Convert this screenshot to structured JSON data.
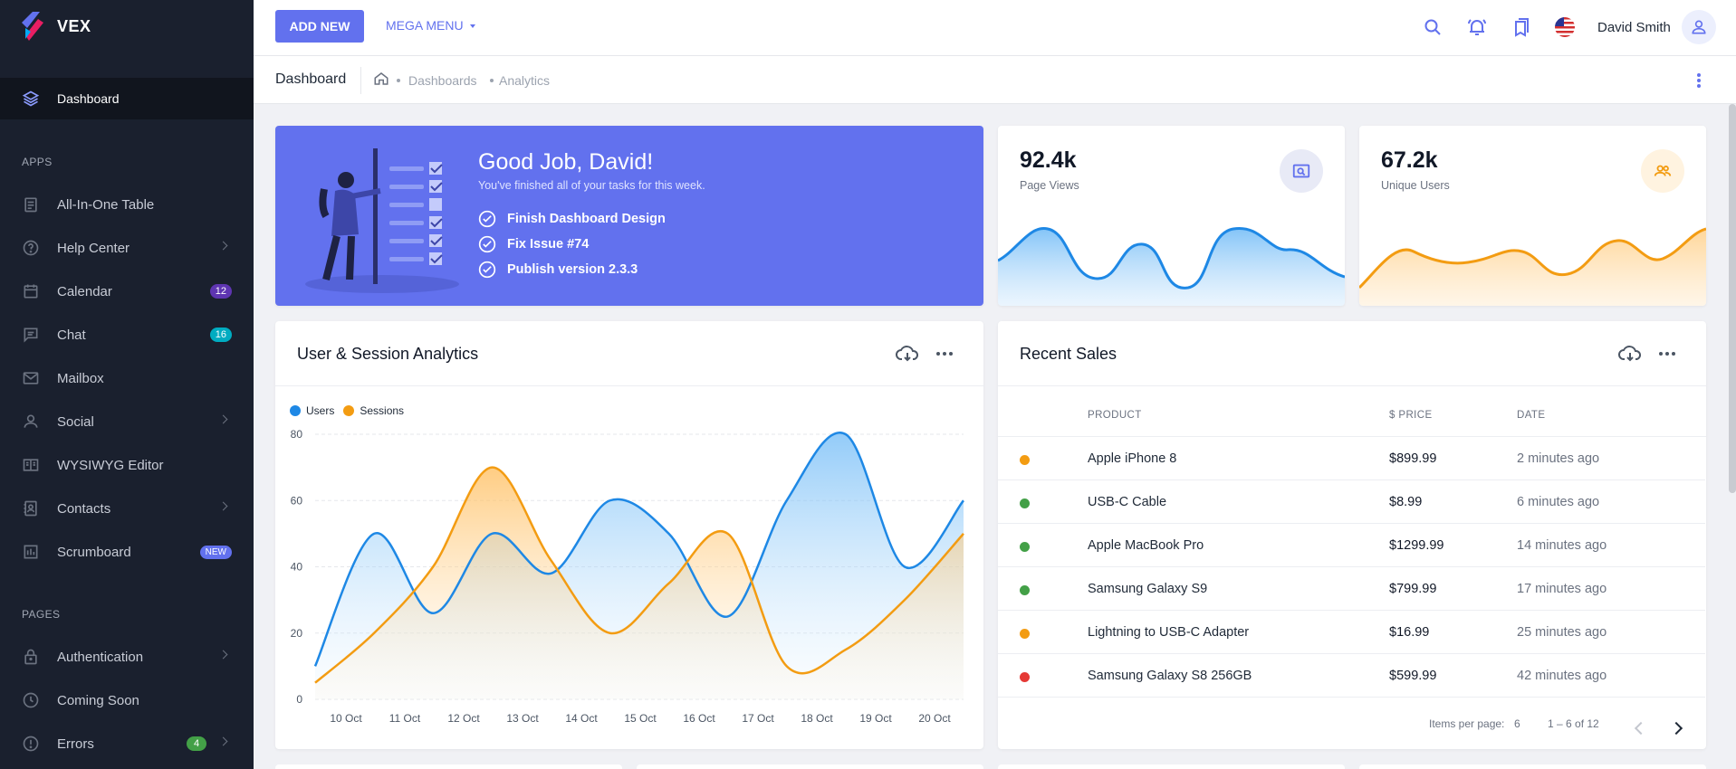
{
  "brand": {
    "name": "VEX"
  },
  "sidebar": {
    "active": {
      "label": "Dashboard"
    },
    "sections": {
      "apps": "APPS",
      "pages": "PAGES"
    },
    "items": [
      {
        "label": "All-In-One Table"
      },
      {
        "label": "Help Center"
      },
      {
        "label": "Calendar",
        "badge": "12"
      },
      {
        "label": "Chat",
        "badge": "16"
      },
      {
        "label": "Mailbox"
      },
      {
        "label": "Social"
      },
      {
        "label": "WYSIWYG Editor"
      },
      {
        "label": "Contacts"
      },
      {
        "label": "Scrumboard",
        "badge": "NEW"
      },
      {
        "label": "Authentication"
      },
      {
        "label": "Coming Soon"
      },
      {
        "label": "Errors",
        "badge": "4"
      }
    ]
  },
  "topbar": {
    "add_new": "ADD NEW",
    "mega_menu": "MEGA MENU",
    "user_name": "David Smith",
    "icons": [
      "search-icon",
      "notifications-icon",
      "bookmarks-icon",
      "us-flag-icon"
    ]
  },
  "breadcrumb": {
    "title": "Dashboard",
    "items": [
      "Dashboards",
      "Analytics"
    ]
  },
  "hero": {
    "title": "Good Job, David!",
    "subtitle": "You've finished all of your tasks for this week.",
    "tasks": [
      "Finish Dashboard Design",
      "Fix Issue #74",
      "Publish version 2.3.3"
    ]
  },
  "stats": [
    {
      "value": "92.4k",
      "label": "Page Views",
      "color": "#1e88e5"
    },
    {
      "value": "67.2k",
      "label": "Unique Users",
      "color": "#f39c12"
    }
  ],
  "analytics": {
    "title": "User & Session Analytics"
  },
  "chart_data": {
    "type": "area",
    "title": "",
    "xlabel": "",
    "ylabel": "",
    "x": [
      "10 Oct",
      "11 Oct",
      "12 Oct",
      "13 Oct",
      "14 Oct",
      "15 Oct",
      "16 Oct",
      "17 Oct",
      "18 Oct",
      "19 Oct",
      "20 Oct"
    ],
    "ylim": [
      0,
      80
    ],
    "yticks": [
      0,
      20,
      40,
      60,
      80
    ],
    "grid": true,
    "legend": "top-left",
    "series": [
      {
        "name": "Users",
        "color": "#1e88e5",
        "values": [
          10,
          50,
          26,
          50,
          38,
          60,
          50,
          25,
          60,
          80,
          40,
          60
        ]
      },
      {
        "name": "Sessions",
        "color": "#f39c12",
        "values": [
          5,
          20,
          40,
          70,
          42,
          20,
          35,
          50,
          10,
          15,
          30,
          50
        ]
      }
    ]
  },
  "sales": {
    "title": "Recent Sales",
    "columns": [
      "PRODUCT",
      "$ PRICE",
      "DATE"
    ],
    "rows": [
      {
        "product": "Apple iPhone 8",
        "price": "$899.99",
        "date": "2 minutes ago",
        "status": "#f39c12"
      },
      {
        "product": "USB-C Cable",
        "price": "$8.99",
        "date": "6 minutes ago",
        "status": "#43a047"
      },
      {
        "product": "Apple MacBook Pro",
        "price": "$1299.99",
        "date": "14 minutes ago",
        "status": "#43a047"
      },
      {
        "product": "Samsung Galaxy S9",
        "price": "$799.99",
        "date": "17 minutes ago",
        "status": "#43a047"
      },
      {
        "product": "Lightning to USB-C Adapter",
        "price": "$16.99",
        "date": "25 minutes ago",
        "status": "#f39c12"
      },
      {
        "product": "Samsung Galaxy S8 256GB",
        "price": "$599.99",
        "date": "42 minutes ago",
        "status": "#e53935"
      }
    ],
    "items_per_page_label": "Items per page:",
    "items_per_page": "6",
    "range": "1 – 6 of 12"
  },
  "colors": {
    "accent": "#6271ee",
    "sidebar": "#1a202e"
  }
}
